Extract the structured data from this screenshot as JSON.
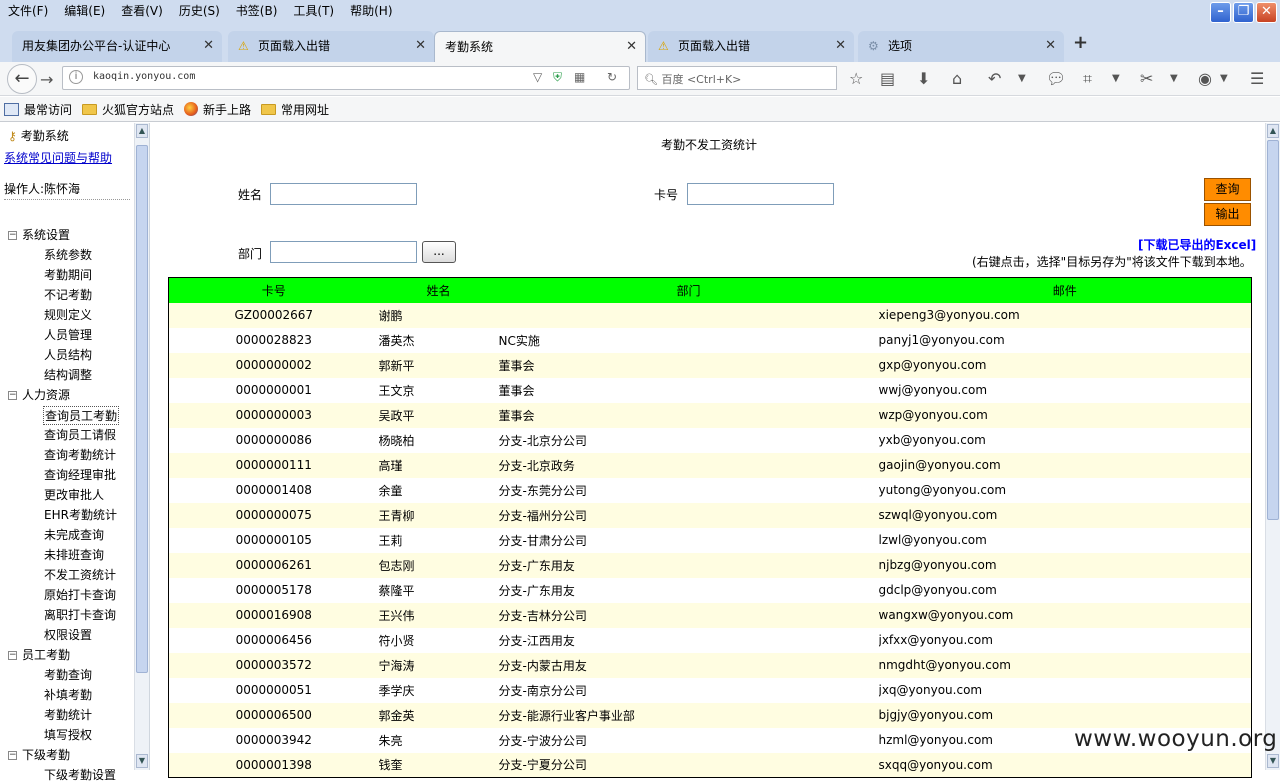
{
  "browser": {
    "menu": [
      "文件(F)",
      "编辑(E)",
      "查看(V)",
      "历史(S)",
      "书签(B)",
      "工具(T)",
      "帮助(H)"
    ],
    "tabs": [
      {
        "title": "用友集团办公平台-认证中心",
        "icon": "none",
        "active": false
      },
      {
        "title": "页面载入出错",
        "icon": "warning-icon",
        "active": false
      },
      {
        "title": "考勤系统",
        "icon": "none",
        "active": true
      },
      {
        "title": "页面载入出错",
        "icon": "warning-icon",
        "active": false
      },
      {
        "title": "选项",
        "icon": "gear-icon",
        "active": false
      }
    ],
    "url": "kaoqin.yonyou.com",
    "search_placeholder": "百度 <Ctrl+K>",
    "bookmarks": [
      "最常访问",
      "火狐官方站点",
      "新手上路",
      "常用网址"
    ]
  },
  "sidebar": {
    "system_title": "考勤系统",
    "help_link": "系统常见问题与帮助",
    "operator": "操作人:陈怀海",
    "groups": [
      {
        "label": "系统设置",
        "items": [
          "系统参数",
          "考勤期间",
          "不记考勤",
          "规则定义",
          "人员管理",
          "人员结构",
          "结构调整"
        ]
      },
      {
        "label": "人力资源",
        "items": [
          "查询员工考勤",
          "查询员工请假",
          "查询考勤统计",
          "查询经理审批",
          "更改审批人",
          "EHR考勤统计",
          "未完成查询",
          "未排班查询",
          "不发工资统计",
          "原始打卡查询",
          "离职打卡查询",
          "权限设置"
        ]
      },
      {
        "label": "员工考勤",
        "items": [
          "考勤查询",
          "补填考勤",
          "考勤统计",
          "填写授权"
        ]
      },
      {
        "label": "下级考勤",
        "items": [
          "下级考勤设置"
        ]
      }
    ],
    "selected_item": "查询员工考勤"
  },
  "main": {
    "title": "考勤不发工资统计",
    "name_label": "姓名",
    "card_label": "卡号",
    "dept_label": "部门",
    "dots_button": "...",
    "query_button": "查询",
    "export_button": "输出",
    "excel_link": "[下载已导出的Excel]",
    "excel_note": "(右键点击，选择\"目标另存为\"将该文件下载到本地。",
    "table": {
      "headers": [
        "卡号",
        "姓名",
        "部门",
        "邮件"
      ],
      "rows": [
        [
          "GZ00002667",
          "谢鹏",
          "",
          "xiepeng3@yonyou.com"
        ],
        [
          "0000028823",
          "潘英杰",
          "NC实施",
          "panyj1@yonyou.com"
        ],
        [
          "0000000002",
          "郭新平",
          "董事会",
          "gxp@yonyou.com"
        ],
        [
          "0000000001",
          "王文京",
          "董事会",
          "wwj@yonyou.com"
        ],
        [
          "0000000003",
          "吴政平",
          "董事会",
          "wzp@yonyou.com"
        ],
        [
          "0000000086",
          "杨晓柏",
          "分支-北京分公司",
          "yxb@yonyou.com"
        ],
        [
          "0000000111",
          "高瑾",
          "分支-北京政务",
          "gaojin@yonyou.com"
        ],
        [
          "0000001408",
          "余童",
          "分支-东莞分公司",
          "yutong@yonyou.com"
        ],
        [
          "0000000075",
          "王青柳",
          "分支-福州分公司",
          "szwql@yonyou.com"
        ],
        [
          "0000000105",
          "王莉",
          "分支-甘肃分公司",
          "lzwl@yonyou.com"
        ],
        [
          "0000006261",
          "包志刚",
          "分支-广东用友",
          "njbzg@yonyou.com"
        ],
        [
          "0000005178",
          "蔡隆平",
          "分支-广东用友",
          "gdclp@yonyou.com"
        ],
        [
          "0000016908",
          "王兴伟",
          "分支-吉林分公司",
          "wangxw@yonyou.com"
        ],
        [
          "0000006456",
          "符小贤",
          "分支-江西用友",
          "jxfxx@yonyou.com"
        ],
        [
          "0000003572",
          "宁海涛",
          "分支-内蒙古用友",
          "nmgdht@yonyou.com"
        ],
        [
          "0000000051",
          "季学庆",
          "分支-南京分公司",
          "jxq@yonyou.com"
        ],
        [
          "0000006500",
          "郭金英",
          "分支-能源行业客户事业部",
          "bjgjy@yonyou.com"
        ],
        [
          "0000003942",
          "朱亮",
          "分支-宁波分公司",
          "hzml@yonyou.com"
        ],
        [
          "0000001398",
          "钱奎",
          "分支-宁夏分公司",
          "sxqq@yonyou.com"
        ]
      ]
    }
  },
  "watermark": "www.wooyun.org"
}
